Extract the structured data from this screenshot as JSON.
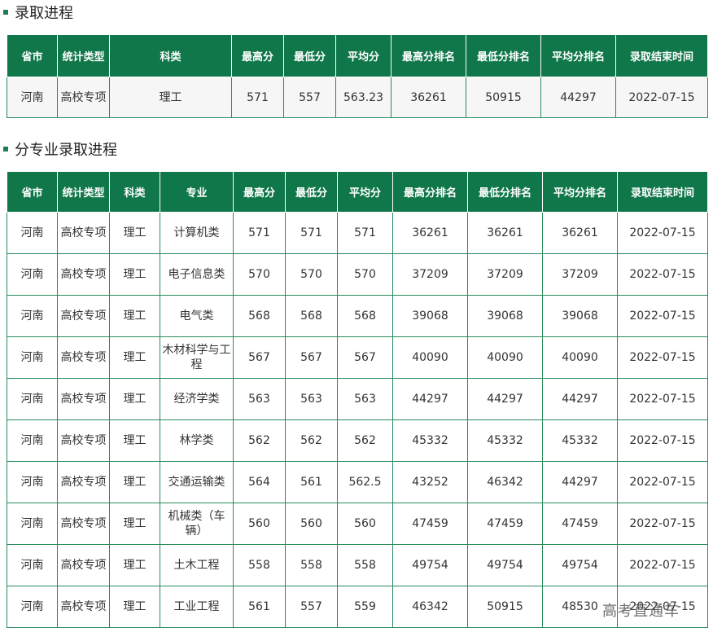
{
  "section1": {
    "title": "录取进程"
  },
  "table1": {
    "headers": [
      "省市",
      "统计类型",
      "科类",
      "最高分",
      "最低分",
      "平均分",
      "最高分排名",
      "最低分排名",
      "平均分排名",
      "录取结束时间"
    ],
    "rows": [
      [
        "河南",
        "高校专项",
        "理工",
        "571",
        "557",
        "563.23",
        "36261",
        "50915",
        "44297",
        "2022-07-15"
      ]
    ]
  },
  "section2": {
    "title": "分专业录取进程"
  },
  "table2": {
    "headers": [
      "省市",
      "统计类型",
      "科类",
      "专业",
      "最高分",
      "最低分",
      "平均分",
      "最高分排名",
      "最低分排名",
      "平均分排名",
      "录取结束时间"
    ],
    "rows": [
      [
        "河南",
        "高校专项",
        "理工",
        "计算机类",
        "571",
        "571",
        "571",
        "36261",
        "36261",
        "36261",
        "2022-07-15"
      ],
      [
        "河南",
        "高校专项",
        "理工",
        "电子信息类",
        "570",
        "570",
        "570",
        "37209",
        "37209",
        "37209",
        "2022-07-15"
      ],
      [
        "河南",
        "高校专项",
        "理工",
        "电气类",
        "568",
        "568",
        "568",
        "39068",
        "39068",
        "39068",
        "2022-07-15"
      ],
      [
        "河南",
        "高校专项",
        "理工",
        "木材科学与工程",
        "567",
        "567",
        "567",
        "40090",
        "40090",
        "40090",
        "2022-07-15"
      ],
      [
        "河南",
        "高校专项",
        "理工",
        "经济学类",
        "563",
        "563",
        "563",
        "44297",
        "44297",
        "44297",
        "2022-07-15"
      ],
      [
        "河南",
        "高校专项",
        "理工",
        "林学类",
        "562",
        "562",
        "562",
        "45332",
        "45332",
        "45332",
        "2022-07-15"
      ],
      [
        "河南",
        "高校专项",
        "理工",
        "交通运输类",
        "564",
        "561",
        "562.5",
        "43252",
        "46342",
        "44297",
        "2022-07-15"
      ],
      [
        "河南",
        "高校专项",
        "理工",
        "机械类（车辆）",
        "560",
        "560",
        "560",
        "47459",
        "47459",
        "47459",
        "2022-07-15"
      ],
      [
        "河南",
        "高校专项",
        "理工",
        "土木工程",
        "558",
        "558",
        "558",
        "49754",
        "49754",
        "49754",
        "2022-07-15"
      ],
      [
        "河南",
        "高校专项",
        "理工",
        "工业工程",
        "561",
        "557",
        "559",
        "46342",
        "50915",
        "48530",
        "2022-07-15"
      ]
    ]
  },
  "watermark": "高考直通车"
}
